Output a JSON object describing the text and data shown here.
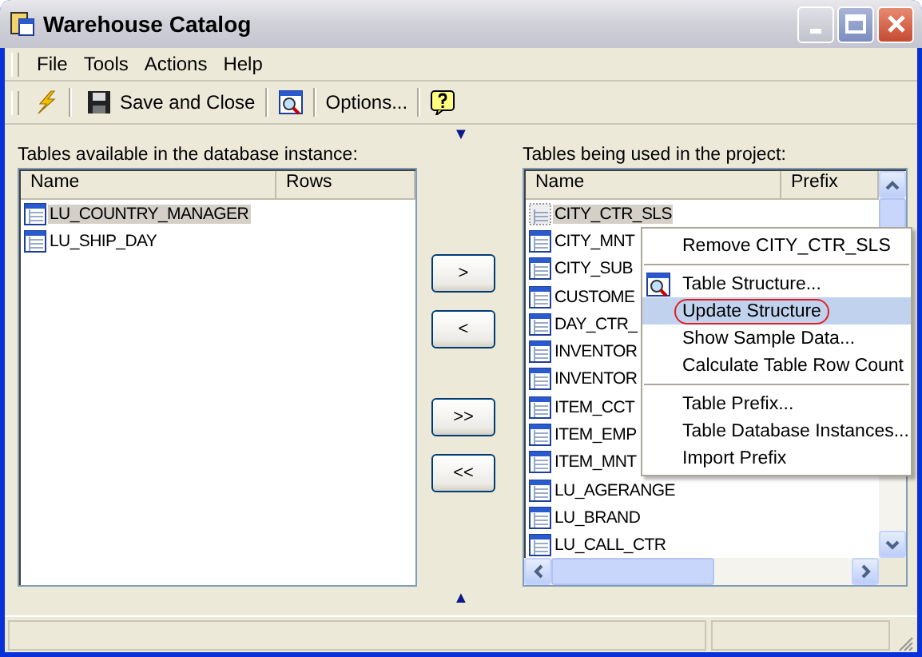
{
  "window": {
    "title": "Warehouse Catalog"
  },
  "menu_bar": [
    "File",
    "Tools",
    "Actions",
    "Help"
  ],
  "toolbar": {
    "save_label": "Save and Close",
    "options_label": "Options..."
  },
  "top_marker": "▼",
  "left_panel": {
    "label": "Tables available in the database instance:",
    "columns": [
      "Name",
      "Rows"
    ],
    "rows": [
      {
        "name": "LU_COUNTRY_MANAGER",
        "selected": true
      },
      {
        "name": "LU_SHIP_DAY",
        "selected": false
      }
    ]
  },
  "move_buttons": [
    ">",
    "<",
    ">>",
    "<<"
  ],
  "right_panel": {
    "label": "Tables being used in the project:",
    "columns": [
      "Name",
      "Prefix"
    ],
    "rows": [
      {
        "name": "CITY_CTR_SLS",
        "selected": true
      },
      {
        "name": "CITY_MNT",
        "selected": false
      },
      {
        "name": "CITY_SUB",
        "selected": false
      },
      {
        "name": "CUSTOME",
        "selected": false
      },
      {
        "name": "DAY_CTR_",
        "selected": false
      },
      {
        "name": "INVENTOR",
        "selected": false
      },
      {
        "name": "INVENTOR",
        "selected": false
      },
      {
        "name": "ITEM_CCT",
        "selected": false
      },
      {
        "name": "ITEM_EMP",
        "selected": false
      },
      {
        "name": "ITEM_MNT",
        "selected": false
      },
      {
        "name": "LU_AGERANGE",
        "selected": false
      },
      {
        "name": "LU_BRAND",
        "selected": false
      },
      {
        "name": "LU_CALL_CTR",
        "selected": false
      }
    ]
  },
  "context_menu": [
    {
      "kind": "item",
      "label": "Remove CITY_CTR_SLS",
      "selected": false,
      "circled": false
    },
    {
      "kind": "separator"
    },
    {
      "kind": "icon-item",
      "label": "Table Structure...",
      "selected": false,
      "circled": false
    },
    {
      "kind": "item",
      "label": "Update Structure",
      "selected": true,
      "circled": true
    },
    {
      "kind": "item",
      "label": "Show Sample Data...",
      "selected": false,
      "circled": false
    },
    {
      "kind": "item",
      "label": "Calculate Table Row Count",
      "selected": false,
      "circled": false
    },
    {
      "kind": "separator"
    },
    {
      "kind": "item",
      "label": "Table Prefix...",
      "selected": false,
      "circled": false
    },
    {
      "kind": "item",
      "label": "Table Database Instances...",
      "selected": false,
      "circled": false
    },
    {
      "kind": "item",
      "label": "Import Prefix",
      "selected": false,
      "circled": false
    }
  ],
  "bottom_marker": "▲"
}
